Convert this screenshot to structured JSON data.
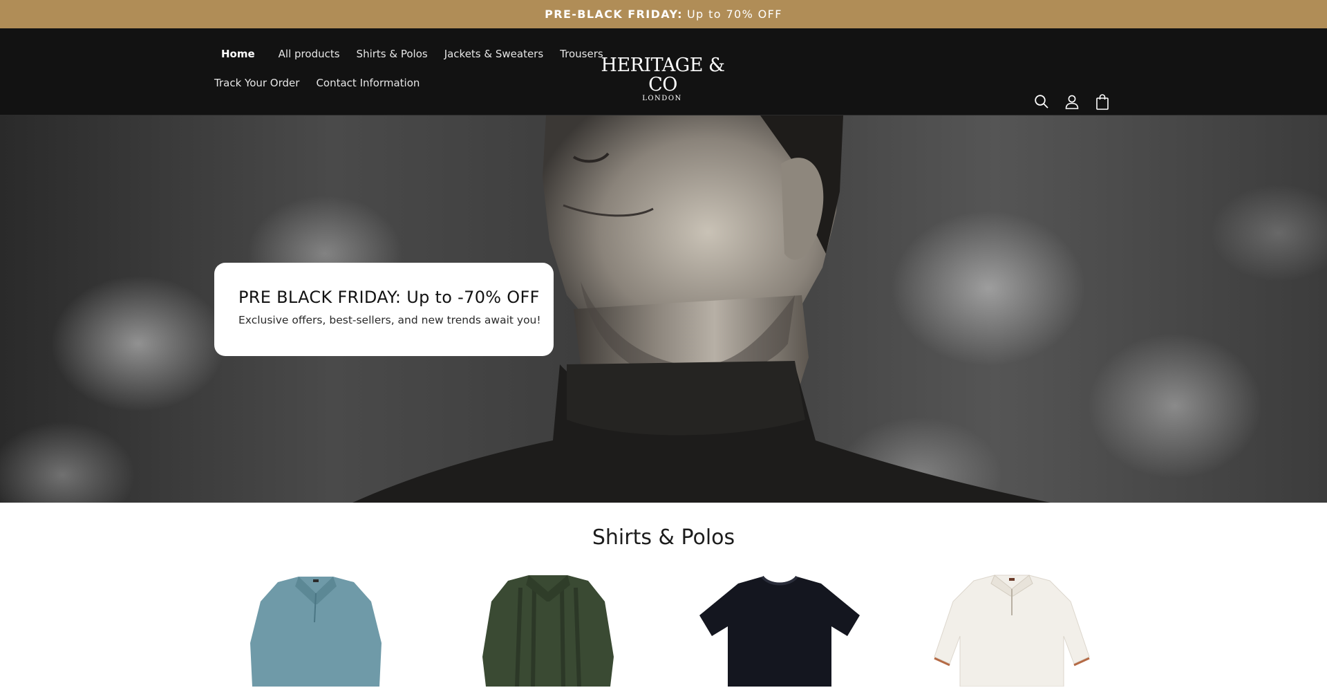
{
  "announcement": {
    "bold": "PRE-BLACK FRIDAY:",
    "rest": "Up to 70% OFF",
    "background": "#b08d57"
  },
  "nav": {
    "items": [
      {
        "label": "Home",
        "active": true
      },
      {
        "label": "All products"
      },
      {
        "label": "Shirts & Polos"
      },
      {
        "label": "Jackets & Sweaters"
      },
      {
        "label": "Trousers"
      },
      {
        "label": "Track Your Order"
      },
      {
        "label": "Contact Information"
      }
    ]
  },
  "logo": {
    "main": "HERITAGE & CO",
    "sub": "LONDON"
  },
  "header_icons": [
    "search-icon",
    "account-icon",
    "cart-icon"
  ],
  "hero": {
    "heading": "PRE BLACK FRIDAY: Up to -70% OFF",
    "subheading": "Exclusive offers, best-sellers, and new trends await you!"
  },
  "collection": {
    "title": "Shirts & Polos",
    "products": [
      {
        "color": "#6f9aa8"
      },
      {
        "color": "#3a4a33"
      },
      {
        "color": "#14161f"
      },
      {
        "color": "#f2efe9"
      }
    ]
  }
}
